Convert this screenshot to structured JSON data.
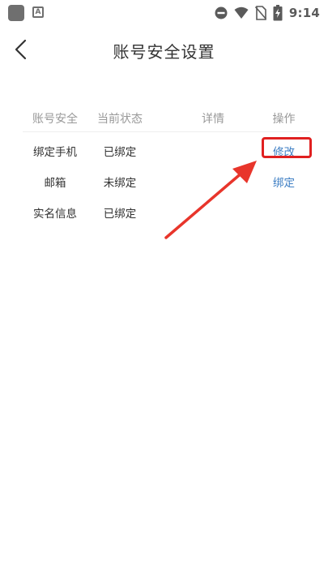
{
  "status_bar": {
    "time": "9:14",
    "notification_letter": "A",
    "icons": [
      "app-notification-icon",
      "a-notification-icon",
      "do-not-disturb-icon",
      "wifi-icon",
      "no-sim-icon",
      "battery-charging-icon"
    ]
  },
  "nav": {
    "back_icon": "chevron-left-icon",
    "title": "账号安全设置"
  },
  "table": {
    "headers": [
      "账号安全",
      "当前状态",
      "详情",
      "操作"
    ],
    "rows": [
      {
        "item": "绑定手机",
        "status": "已绑定",
        "detail": "",
        "action": "修改"
      },
      {
        "item": "邮箱",
        "status": "未绑定",
        "detail": "",
        "action": "绑定"
      },
      {
        "item": "实名信息",
        "status": "已绑定",
        "detail": "",
        "action": ""
      }
    ]
  },
  "annotation": {
    "highlight_color": "#e02020",
    "arrow_color": "#e8352b"
  },
  "colors": {
    "link": "#3f7fc4",
    "header_text": "#999999",
    "body_text": "#333333"
  }
}
